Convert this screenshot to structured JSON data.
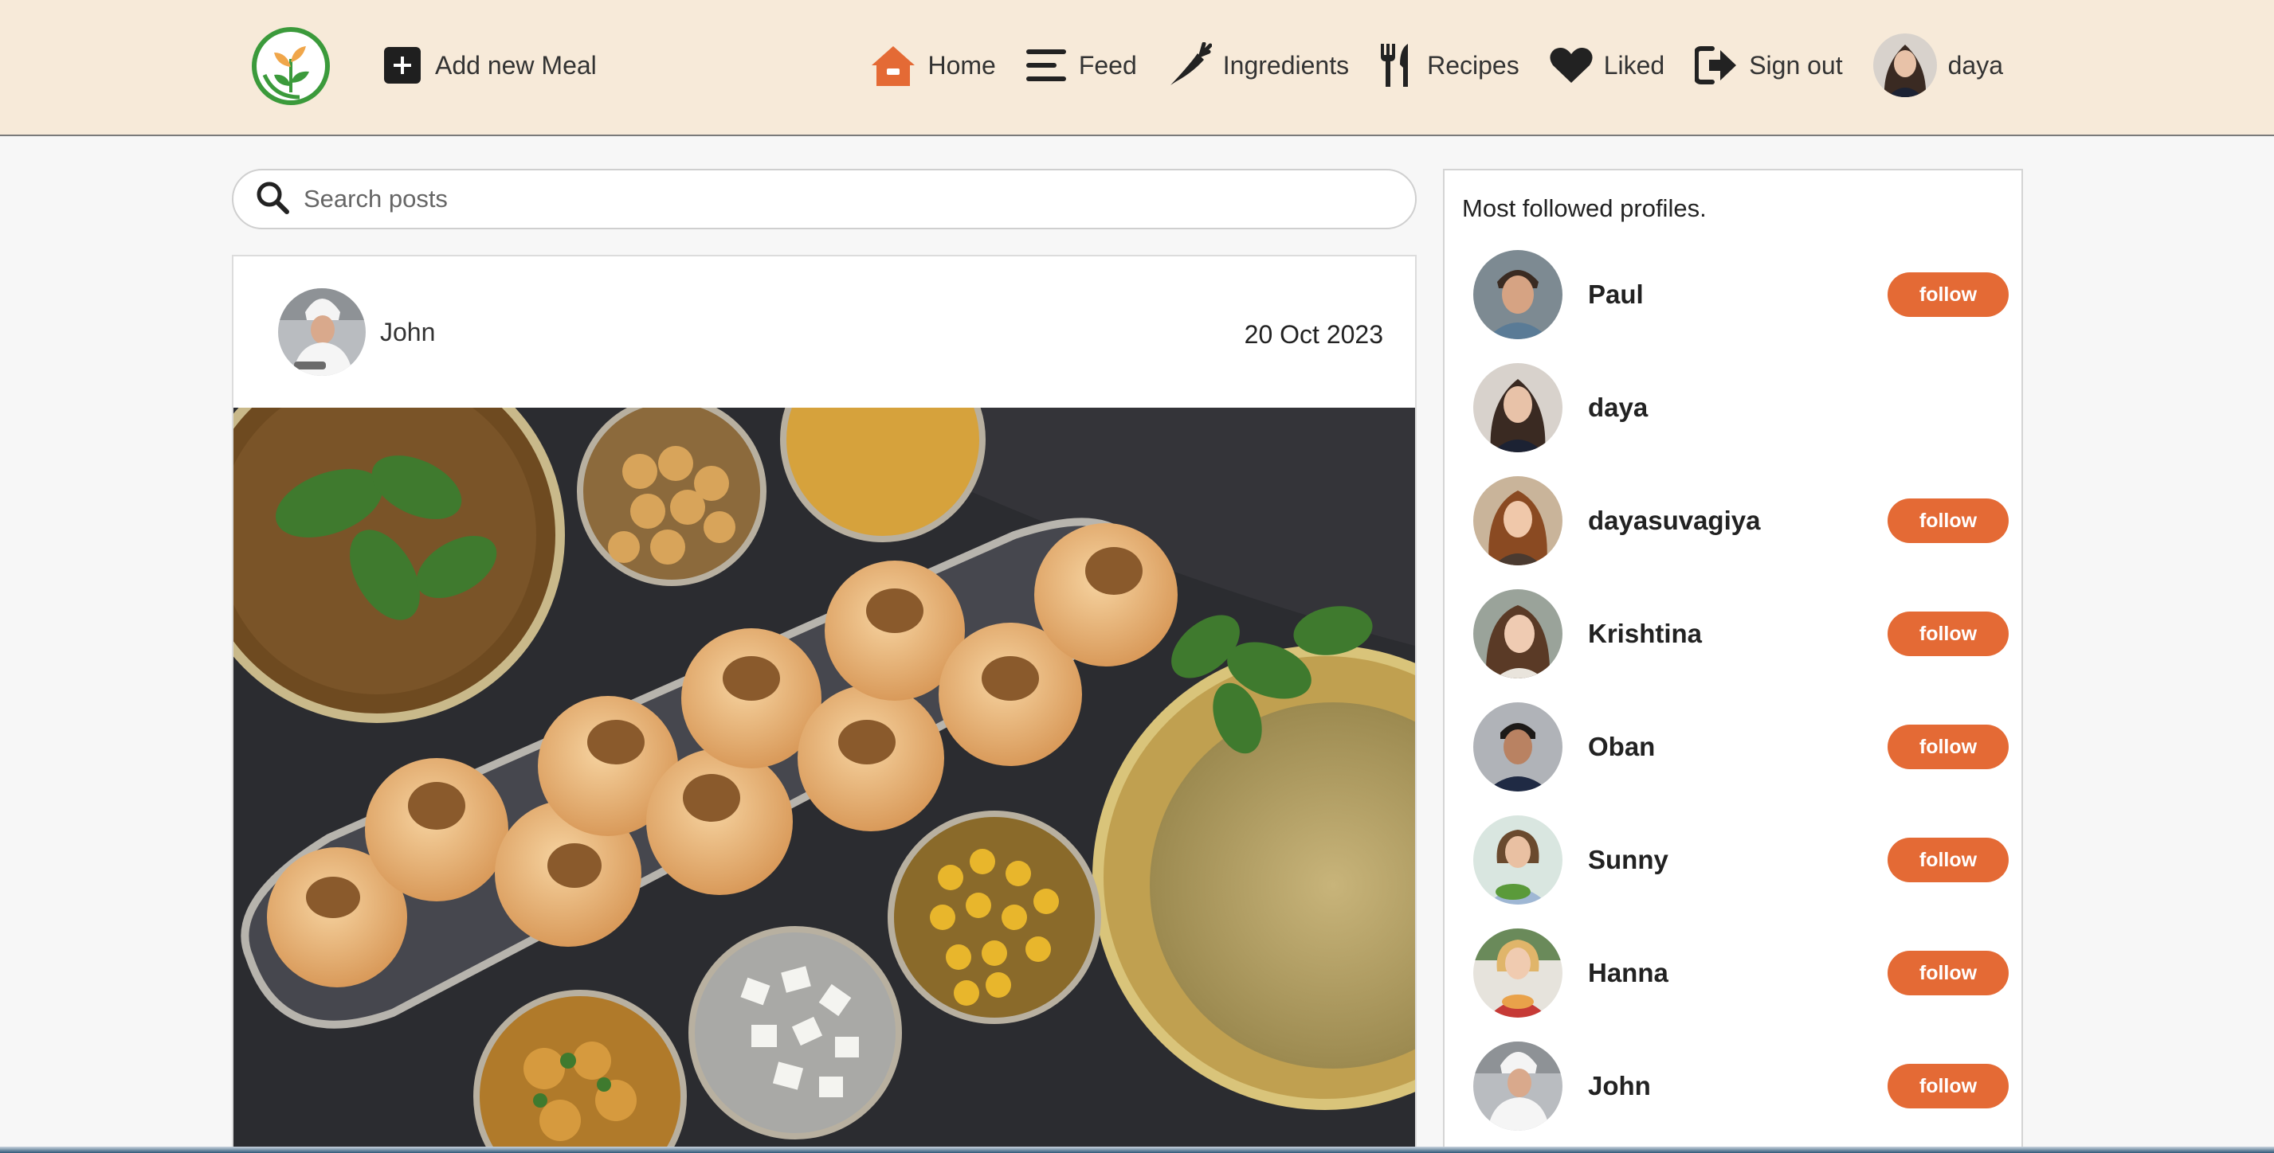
{
  "header": {
    "logo_icon": "sprout-logo-icon",
    "add_meal_label": "Add new Meal",
    "nav": [
      {
        "id": "home",
        "label": "Home",
        "icon": "home-icon"
      },
      {
        "id": "feed",
        "label": "Feed",
        "icon": "feed-icon"
      },
      {
        "id": "ingredients",
        "label": "Ingredients",
        "icon": "carrot-icon"
      },
      {
        "id": "recipes",
        "label": "Recipes",
        "icon": "utensils-icon"
      },
      {
        "id": "liked",
        "label": "Liked",
        "icon": "heart-icon"
      },
      {
        "id": "signout",
        "label": "Sign out",
        "icon": "sign-out-icon"
      }
    ],
    "user_name": "daya",
    "accent_color": "#e46a35",
    "background_color": "#f7ead9"
  },
  "search": {
    "placeholder": "Search posts",
    "value": ""
  },
  "post": {
    "author": "John",
    "date": "20 Oct 2023",
    "image_icon": "food-photo"
  },
  "sidebar": {
    "title": "Most followed profiles.",
    "follow_label": "follow",
    "profiles": [
      {
        "name": "Paul",
        "show_follow": true
      },
      {
        "name": "daya",
        "show_follow": false
      },
      {
        "name": "dayasuvagiya",
        "show_follow": true
      },
      {
        "name": "Krishtina",
        "show_follow": true
      },
      {
        "name": "Oban",
        "show_follow": true
      },
      {
        "name": "Sunny",
        "show_follow": true
      },
      {
        "name": "Hanna",
        "show_follow": true
      },
      {
        "name": "John",
        "show_follow": true
      }
    ]
  }
}
